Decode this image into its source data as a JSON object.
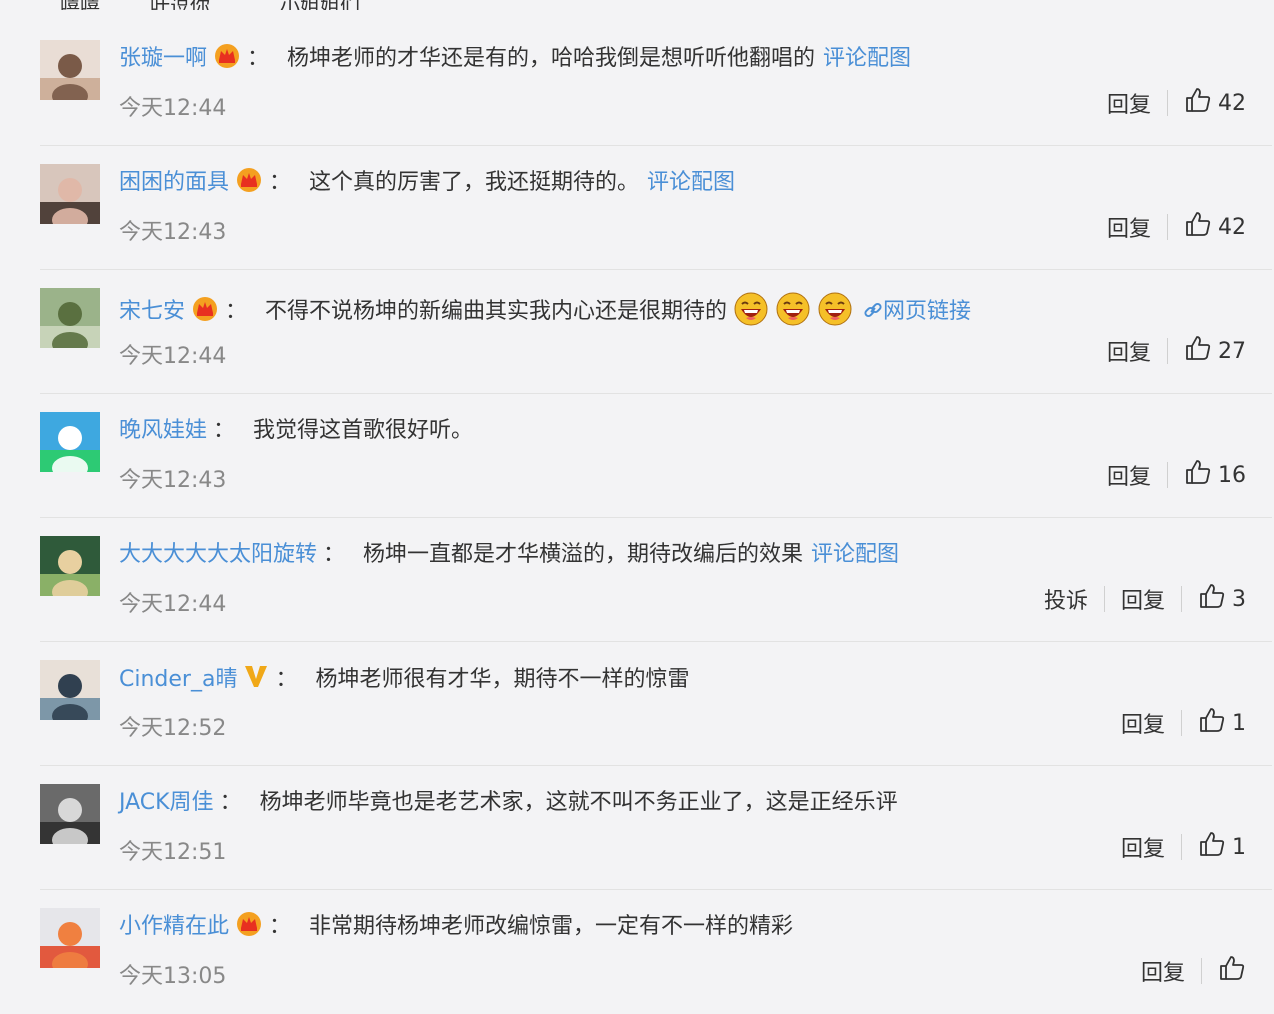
{
  "top_strip": [
    "嘻嘻",
    "叶逗你",
    "小姐姐们"
  ],
  "actions": {
    "reply": "回复",
    "report": "投诉"
  },
  "colors": {
    "link": "#4a8fd6",
    "text": "#333333",
    "time": "#888888"
  },
  "comments": [
    {
      "user": "张璇一啊",
      "badge": "crown-icon",
      "colon": "：",
      "text": "杨坤老师的才华还是有的，哈哈我倒是想听听他翻唱的",
      "link": "评论配图",
      "time": "今天12:44",
      "likes": "42"
    },
    {
      "user": "困困的面具",
      "badge": "crown-icon",
      "colon": "：",
      "text": "这个真的厉害了，我还挺期待的。",
      "link": "评论配图",
      "time": "今天12:43",
      "likes": "42"
    },
    {
      "user": "宋七安",
      "badge": "crown-icon",
      "colon": "：",
      "text": "不得不说杨坤的新编曲其实我内心还是很期待的",
      "emojis": [
        "laughing-emoji",
        "laughing-emoji",
        "laughing-emoji"
      ],
      "link": "网页链接",
      "time": "今天12:44",
      "likes": "27"
    },
    {
      "user": "晚风娃娃",
      "colon": "：",
      "text": "我觉得这首歌很好听。",
      "time": "今天12:43",
      "likes": "16"
    },
    {
      "user": "大大大大大太阳旋转",
      "colon": "：",
      "text": "杨坤一直都是才华横溢的，期待改编后的效果",
      "link": "评论配图",
      "time": "今天12:44",
      "likes": "3",
      "has_report": true
    },
    {
      "user": "Cinder_a晴",
      "badge": "v-icon",
      "colon": "：",
      "text": "杨坤老师很有才华，期待不一样的惊雷",
      "time": "今天12:52",
      "likes": "1"
    },
    {
      "user": "JACK周佳",
      "colon": "：",
      "text": "杨坤老师毕竟也是老艺术家，这就不叫不务正业了，这是正经乐评",
      "time": "今天12:51",
      "likes": "1"
    },
    {
      "user": "小作精在此",
      "badge": "crown-icon",
      "colon": "：",
      "text": "非常期待杨坤老师改编惊雷，一定有不一样的精彩",
      "time": "今天13:05",
      "likes": ""
    }
  ]
}
